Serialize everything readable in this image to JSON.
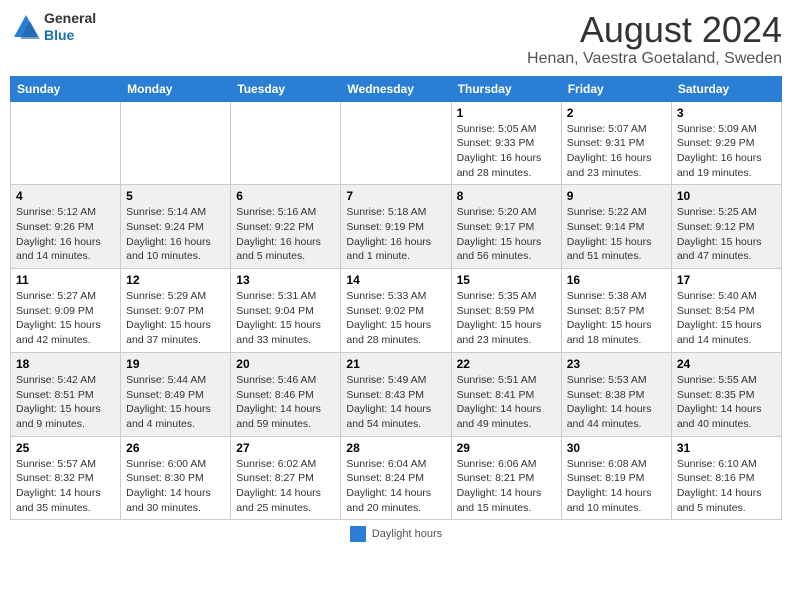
{
  "header": {
    "logo_general": "General",
    "logo_blue": "Blue",
    "title": "August 2024",
    "subtitle": "Henan, Vaestra Goetaland, Sweden"
  },
  "days_of_week": [
    "Sunday",
    "Monday",
    "Tuesday",
    "Wednesday",
    "Thursday",
    "Friday",
    "Saturday"
  ],
  "weeks": [
    [
      {
        "day": "",
        "info": ""
      },
      {
        "day": "",
        "info": ""
      },
      {
        "day": "",
        "info": ""
      },
      {
        "day": "",
        "info": ""
      },
      {
        "day": "1",
        "info": "Sunrise: 5:05 AM\nSunset: 9:33 PM\nDaylight: 16 hours and 28 minutes."
      },
      {
        "day": "2",
        "info": "Sunrise: 5:07 AM\nSunset: 9:31 PM\nDaylight: 16 hours and 23 minutes."
      },
      {
        "day": "3",
        "info": "Sunrise: 5:09 AM\nSunset: 9:29 PM\nDaylight: 16 hours and 19 minutes."
      }
    ],
    [
      {
        "day": "4",
        "info": "Sunrise: 5:12 AM\nSunset: 9:26 PM\nDaylight: 16 hours and 14 minutes."
      },
      {
        "day": "5",
        "info": "Sunrise: 5:14 AM\nSunset: 9:24 PM\nDaylight: 16 hours and 10 minutes."
      },
      {
        "day": "6",
        "info": "Sunrise: 5:16 AM\nSunset: 9:22 PM\nDaylight: 16 hours and 5 minutes."
      },
      {
        "day": "7",
        "info": "Sunrise: 5:18 AM\nSunset: 9:19 PM\nDaylight: 16 hours and 1 minute."
      },
      {
        "day": "8",
        "info": "Sunrise: 5:20 AM\nSunset: 9:17 PM\nDaylight: 15 hours and 56 minutes."
      },
      {
        "day": "9",
        "info": "Sunrise: 5:22 AM\nSunset: 9:14 PM\nDaylight: 15 hours and 51 minutes."
      },
      {
        "day": "10",
        "info": "Sunrise: 5:25 AM\nSunset: 9:12 PM\nDaylight: 15 hours and 47 minutes."
      }
    ],
    [
      {
        "day": "11",
        "info": "Sunrise: 5:27 AM\nSunset: 9:09 PM\nDaylight: 15 hours and 42 minutes."
      },
      {
        "day": "12",
        "info": "Sunrise: 5:29 AM\nSunset: 9:07 PM\nDaylight: 15 hours and 37 minutes."
      },
      {
        "day": "13",
        "info": "Sunrise: 5:31 AM\nSunset: 9:04 PM\nDaylight: 15 hours and 33 minutes."
      },
      {
        "day": "14",
        "info": "Sunrise: 5:33 AM\nSunset: 9:02 PM\nDaylight: 15 hours and 28 minutes."
      },
      {
        "day": "15",
        "info": "Sunrise: 5:35 AM\nSunset: 8:59 PM\nDaylight: 15 hours and 23 minutes."
      },
      {
        "day": "16",
        "info": "Sunrise: 5:38 AM\nSunset: 8:57 PM\nDaylight: 15 hours and 18 minutes."
      },
      {
        "day": "17",
        "info": "Sunrise: 5:40 AM\nSunset: 8:54 PM\nDaylight: 15 hours and 14 minutes."
      }
    ],
    [
      {
        "day": "18",
        "info": "Sunrise: 5:42 AM\nSunset: 8:51 PM\nDaylight: 15 hours and 9 minutes."
      },
      {
        "day": "19",
        "info": "Sunrise: 5:44 AM\nSunset: 8:49 PM\nDaylight: 15 hours and 4 minutes."
      },
      {
        "day": "20",
        "info": "Sunrise: 5:46 AM\nSunset: 8:46 PM\nDaylight: 14 hours and 59 minutes."
      },
      {
        "day": "21",
        "info": "Sunrise: 5:49 AM\nSunset: 8:43 PM\nDaylight: 14 hours and 54 minutes."
      },
      {
        "day": "22",
        "info": "Sunrise: 5:51 AM\nSunset: 8:41 PM\nDaylight: 14 hours and 49 minutes."
      },
      {
        "day": "23",
        "info": "Sunrise: 5:53 AM\nSunset: 8:38 PM\nDaylight: 14 hours and 44 minutes."
      },
      {
        "day": "24",
        "info": "Sunrise: 5:55 AM\nSunset: 8:35 PM\nDaylight: 14 hours and 40 minutes."
      }
    ],
    [
      {
        "day": "25",
        "info": "Sunrise: 5:57 AM\nSunset: 8:32 PM\nDaylight: 14 hours and 35 minutes."
      },
      {
        "day": "26",
        "info": "Sunrise: 6:00 AM\nSunset: 8:30 PM\nDaylight: 14 hours and 30 minutes."
      },
      {
        "day": "27",
        "info": "Sunrise: 6:02 AM\nSunset: 8:27 PM\nDaylight: 14 hours and 25 minutes."
      },
      {
        "day": "28",
        "info": "Sunrise: 6:04 AM\nSunset: 8:24 PM\nDaylight: 14 hours and 20 minutes."
      },
      {
        "day": "29",
        "info": "Sunrise: 6:06 AM\nSunset: 8:21 PM\nDaylight: 14 hours and 15 minutes."
      },
      {
        "day": "30",
        "info": "Sunrise: 6:08 AM\nSunset: 8:19 PM\nDaylight: 14 hours and 10 minutes."
      },
      {
        "day": "31",
        "info": "Sunrise: 6:10 AM\nSunset: 8:16 PM\nDaylight: 14 hours and 5 minutes."
      }
    ]
  ],
  "footer": {
    "swatch_label": "Daylight hours"
  }
}
